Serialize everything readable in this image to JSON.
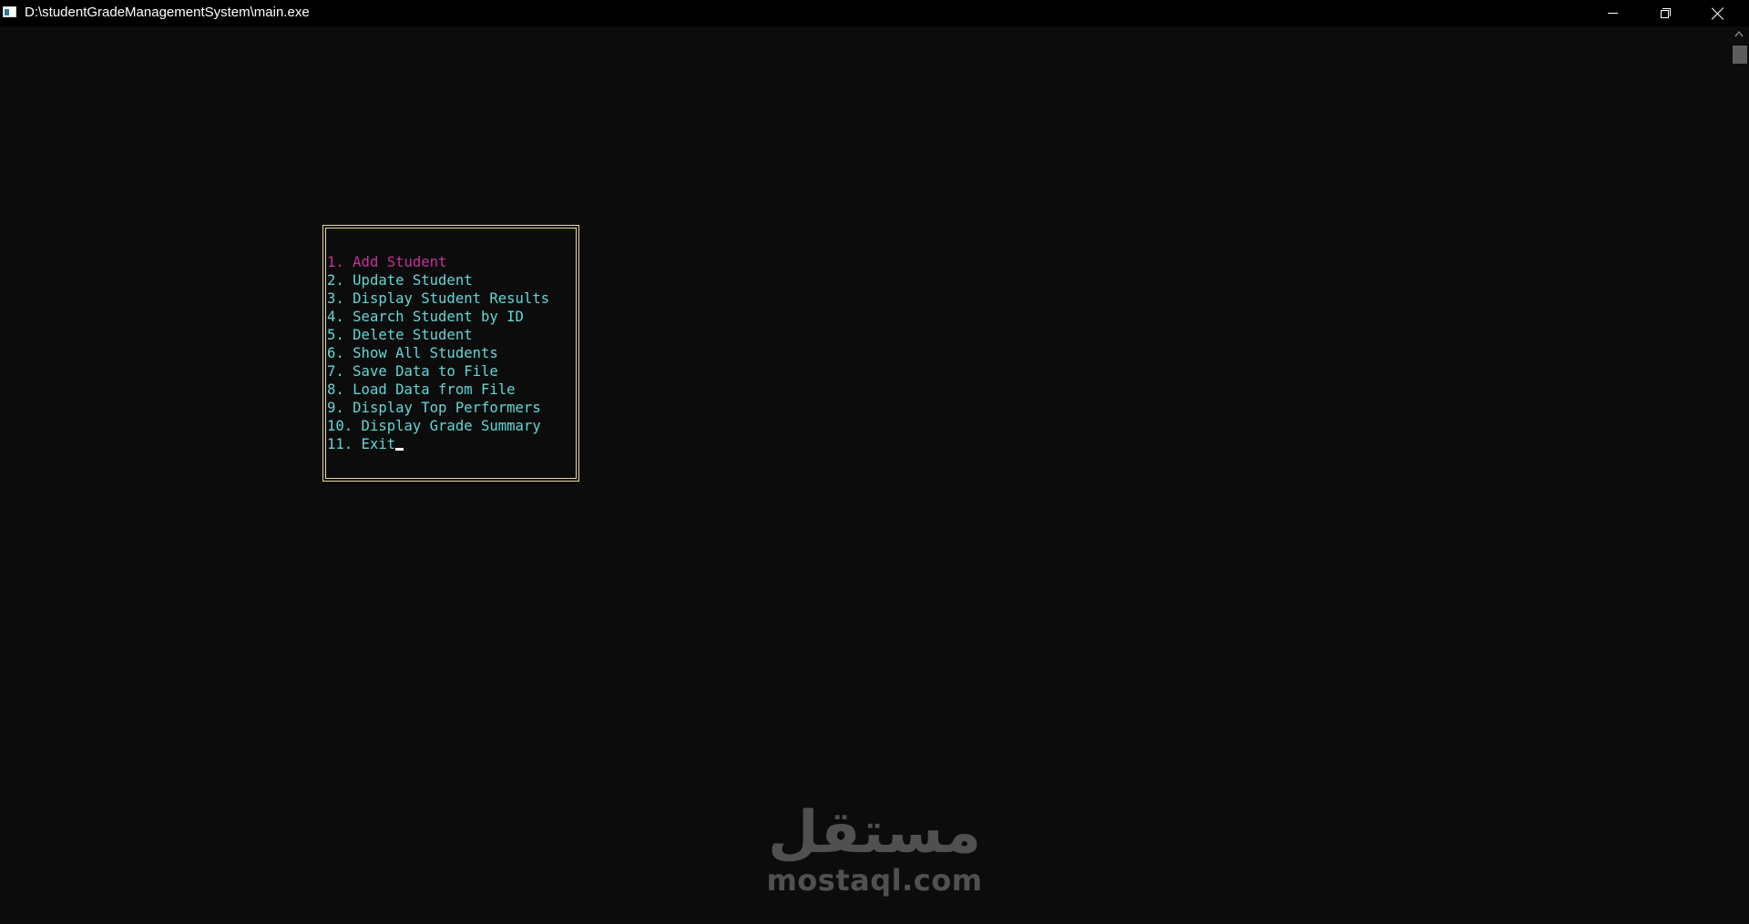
{
  "window": {
    "title": "D:\\studentGradeManagementSystem\\main.exe"
  },
  "titlebar": {
    "icon": "console-app-icon",
    "buttons": [
      "minimize",
      "restore",
      "close"
    ]
  },
  "menu": {
    "items": [
      {
        "label": "1. Add Student",
        "selected": true
      },
      {
        "label": "2. Update Student",
        "selected": false
      },
      {
        "label": "3. Display Student Results",
        "selected": false
      },
      {
        "label": "4. Search Student by ID",
        "selected": false
      },
      {
        "label": "5. Delete Student",
        "selected": false
      },
      {
        "label": "6. Show All Students",
        "selected": false
      },
      {
        "label": "7. Save Data to File",
        "selected": false
      },
      {
        "label": "8. Load Data from File",
        "selected": false
      },
      {
        "label": "9. Display Top Performers",
        "selected": false
      },
      {
        "label": "10. Display Grade Summary",
        "selected": false
      },
      {
        "label": "11. Exit",
        "selected": false
      }
    ]
  },
  "colors": {
    "background": "#0c0c0c",
    "menu_text": "#61d6d6",
    "selected_text": "#c2329a",
    "border": "#e8dca0"
  },
  "watermark": {
    "arabic": "مستقل",
    "latin": "mostaql.com"
  }
}
